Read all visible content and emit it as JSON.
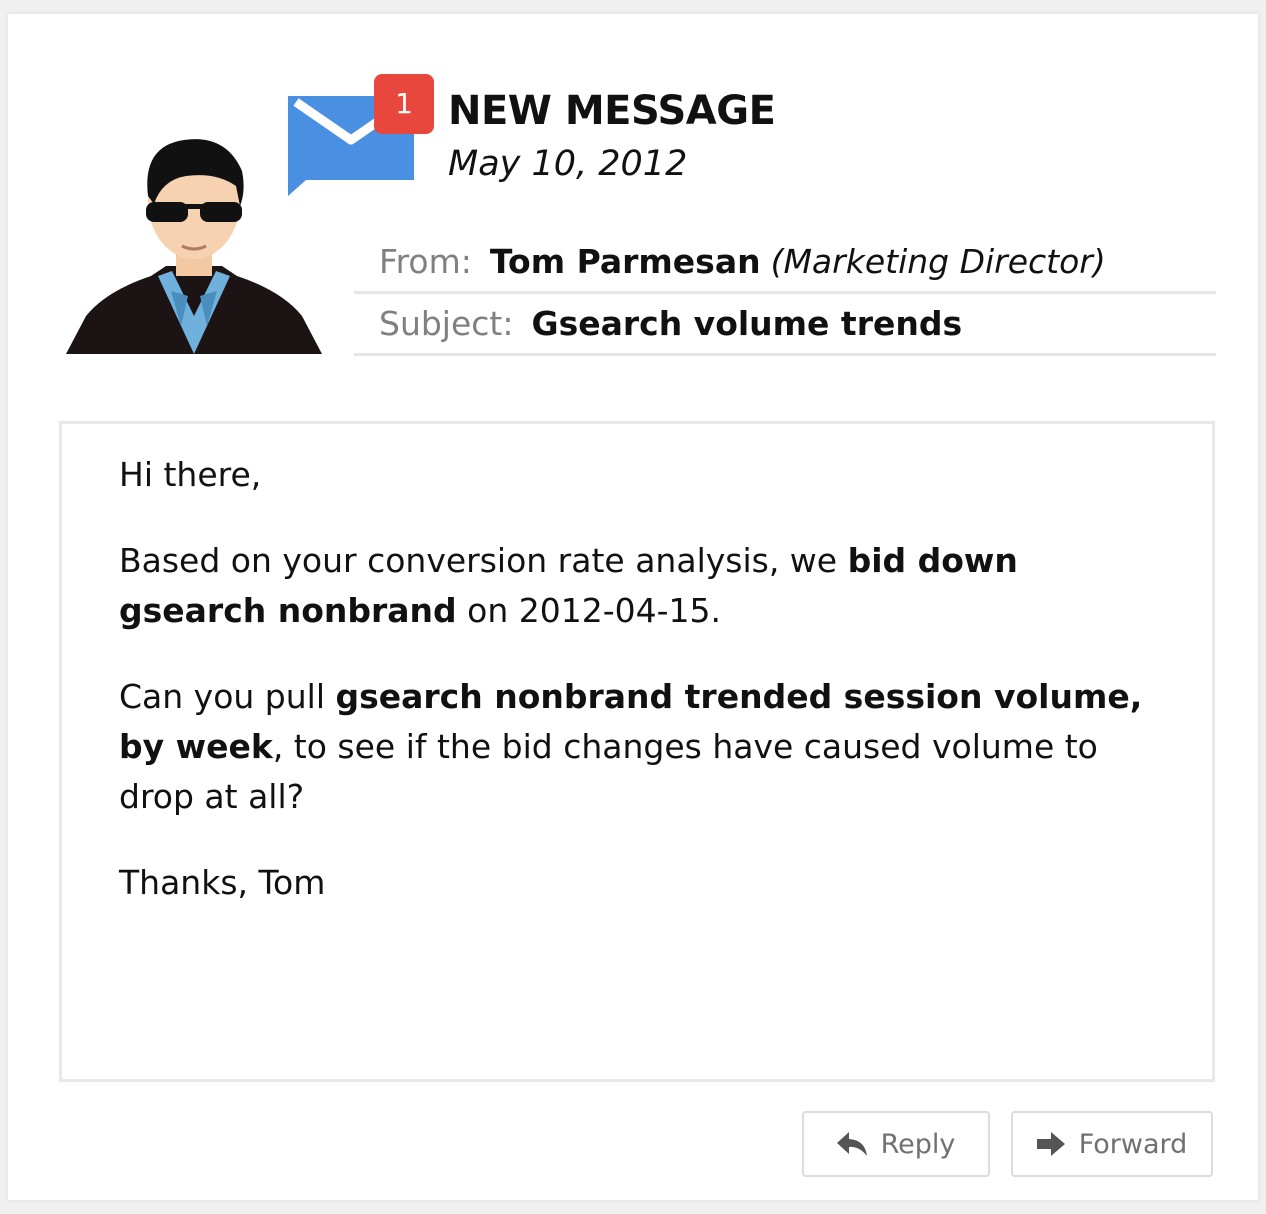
{
  "header": {
    "badge_count": "1",
    "title": "NEW MESSAGE",
    "date": "May 10, 2012"
  },
  "meta": {
    "from_label": "From:",
    "from_name": "Tom Parmesan",
    "from_role": "(Marketing Director)",
    "subject_label": "Subject:",
    "subject_value": "Gsearch volume trends"
  },
  "body": {
    "greeting": "Hi there,",
    "p1_a": "Based on your conversion rate analysis, we ",
    "p1_b": "bid down gsearch nonbrand",
    "p1_c": " on 2012-04-15.",
    "p2_a": "Can you pull ",
    "p2_b": "gsearch nonbrand trended session volume, by week",
    "p2_c": ", to see if the bid changes have caused volume to drop at all?",
    "signoff": "Thanks, Tom"
  },
  "actions": {
    "reply_label": "Reply",
    "forward_label": "Forward"
  },
  "icons": {
    "avatar": "avatar-icon",
    "envelope": "envelope-icon",
    "reply": "reply-arrow-icon",
    "forward": "forward-arrow-icon"
  },
  "colors": {
    "badge": "#e8473d",
    "envelope": "#4a90e2"
  }
}
